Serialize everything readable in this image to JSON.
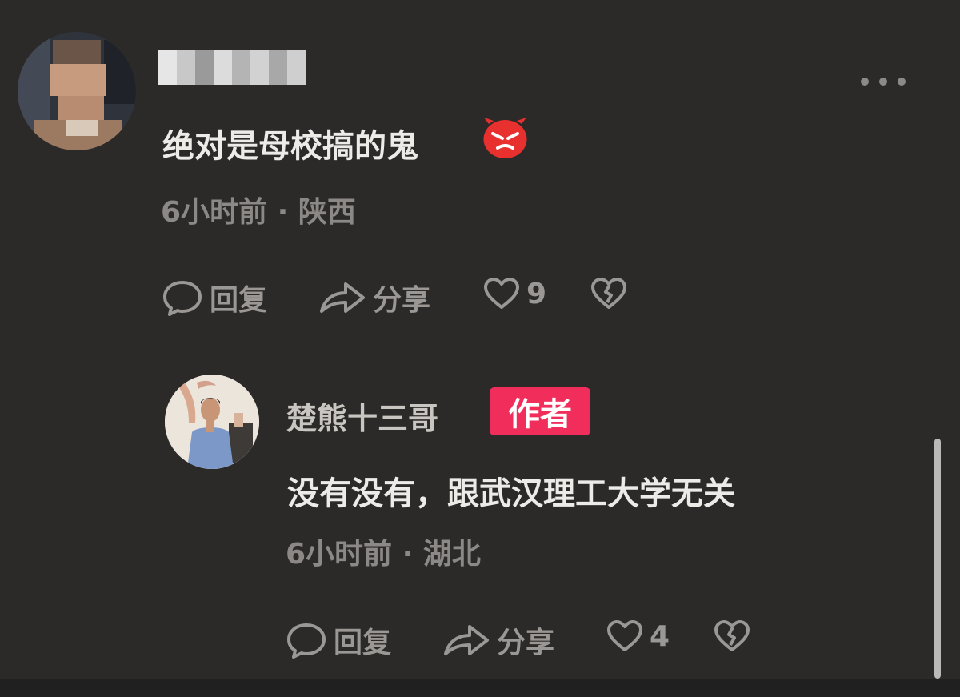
{
  "comment": {
    "text": "绝对是母校搞的鬼",
    "emoji_icon": "angry-face-emoji",
    "time": "6小时前",
    "location": "陕西",
    "reply_label": "回复",
    "share_label": "分享",
    "like_count": "9"
  },
  "reply": {
    "username": "楚熊十三哥",
    "badge": "作者",
    "text": "没有没有，跟武汉理工大学无关",
    "time": "6小时前",
    "location": "湖北",
    "reply_label": "回复",
    "share_label": "分享",
    "like_count": "4"
  },
  "colors": {
    "background": "#2c2a29",
    "author_badge": "#f12e5b",
    "emoji": "#e8312f"
  }
}
